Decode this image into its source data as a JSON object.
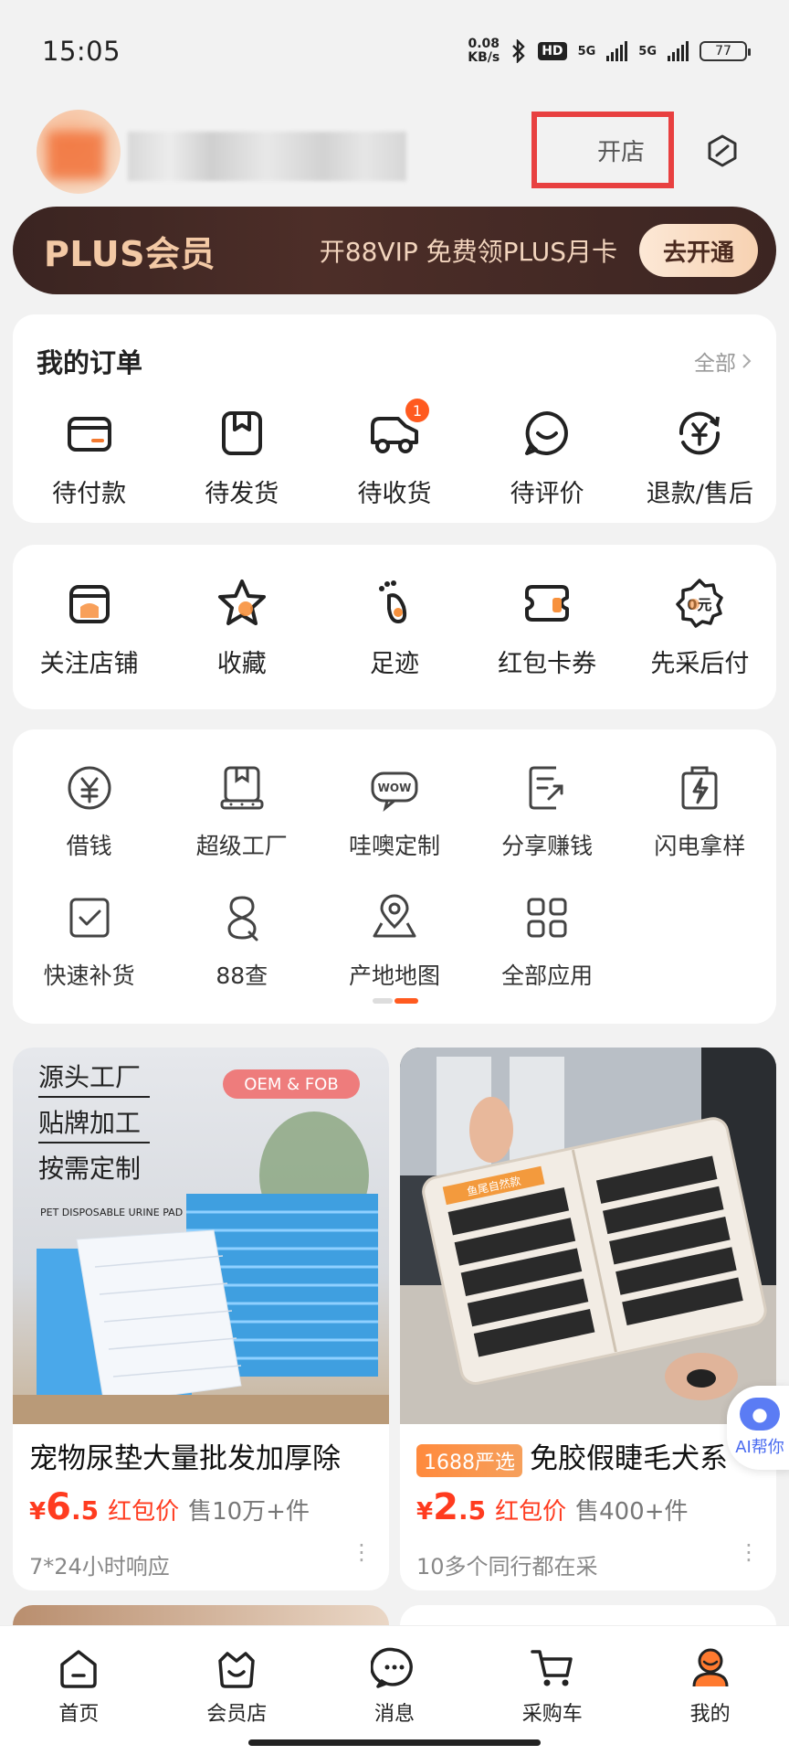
{
  "status": {
    "time": "15:05",
    "speed": "0.08",
    "speed_unit": "KB/s",
    "hd": "HD",
    "net1": "5G",
    "net2": "5G",
    "battery": "77"
  },
  "header": {
    "open_shop": "开店"
  },
  "plus": {
    "title": "PLUS会员",
    "desc": "开88VIP 免费领PLUS月卡",
    "button": "去开通"
  },
  "orders": {
    "title": "我的订单",
    "all": "全部",
    "items": [
      {
        "label": "待付款",
        "icon": "wallet-icon"
      },
      {
        "label": "待发货",
        "icon": "package-icon"
      },
      {
        "label": "待收货",
        "icon": "truck-icon",
        "badge": "1"
      },
      {
        "label": "待评价",
        "icon": "comment-icon"
      },
      {
        "label": "退款/售后",
        "icon": "refund-icon"
      }
    ]
  },
  "favorites": {
    "items": [
      {
        "label": "关注店铺",
        "icon": "shop-icon"
      },
      {
        "label": "收藏",
        "icon": "star-icon"
      },
      {
        "label": "足迹",
        "icon": "footprint-icon"
      },
      {
        "label": "红包卡券",
        "icon": "coupon-icon"
      },
      {
        "label": "先采后付",
        "icon": "pay-later-icon",
        "icon_text": "0元"
      }
    ]
  },
  "apps": {
    "row1": [
      {
        "label": "借钱",
        "icon": "yen-icon"
      },
      {
        "label": "超级工厂",
        "icon": "factory-icon"
      },
      {
        "label": "哇噢定制",
        "icon": "wow-icon",
        "icon_text": "WOW"
      },
      {
        "label": "分享赚钱",
        "icon": "share-icon"
      },
      {
        "label": "闪电拿样",
        "icon": "lightning-icon"
      }
    ],
    "row2": [
      {
        "label": "快速补货",
        "icon": "check-icon"
      },
      {
        "label": "88查",
        "icon": "eight-icon"
      },
      {
        "label": "产地地图",
        "icon": "map-pin-icon"
      },
      {
        "label": "全部应用",
        "icon": "grid-icon"
      }
    ]
  },
  "products": [
    {
      "img_lines": [
        "源头工厂",
        "贴牌加工",
        "按需定制"
      ],
      "img_tag": "OEM & FOB",
      "img_caption": "PET DISPOSABLE URINE PAD",
      "title": "宠物尿垫大量批发加厚除",
      "price_yen": "¥",
      "price_int": "6",
      "price_dec": ".5",
      "price_tag": "红包价",
      "sold": "售10万+件",
      "sub": "7*24小时响应"
    },
    {
      "img_tag_text": "鱼尾自然款",
      "tag": "1688严选",
      "title": "免胶假睫毛犬系",
      "price_yen": "¥",
      "price_int": "2",
      "price_dec": ".5",
      "price_tag": "红包价",
      "sold": "售400+件",
      "sub": "10多个同行都在采"
    }
  ],
  "ai_help": {
    "label": "AI帮你"
  },
  "tabbar": [
    {
      "label": "首页",
      "icon": "home-icon"
    },
    {
      "label": "会员店",
      "icon": "member-shop-icon"
    },
    {
      "label": "消息",
      "icon": "message-icon"
    },
    {
      "label": "采购车",
      "icon": "cart-icon"
    },
    {
      "label": "我的",
      "icon": "profile-icon"
    }
  ],
  "colors": {
    "accent": "#ff5a1f",
    "price": "#ff3b1f",
    "plus_bg": "#3a2421",
    "highlight_box": "#e84040"
  }
}
